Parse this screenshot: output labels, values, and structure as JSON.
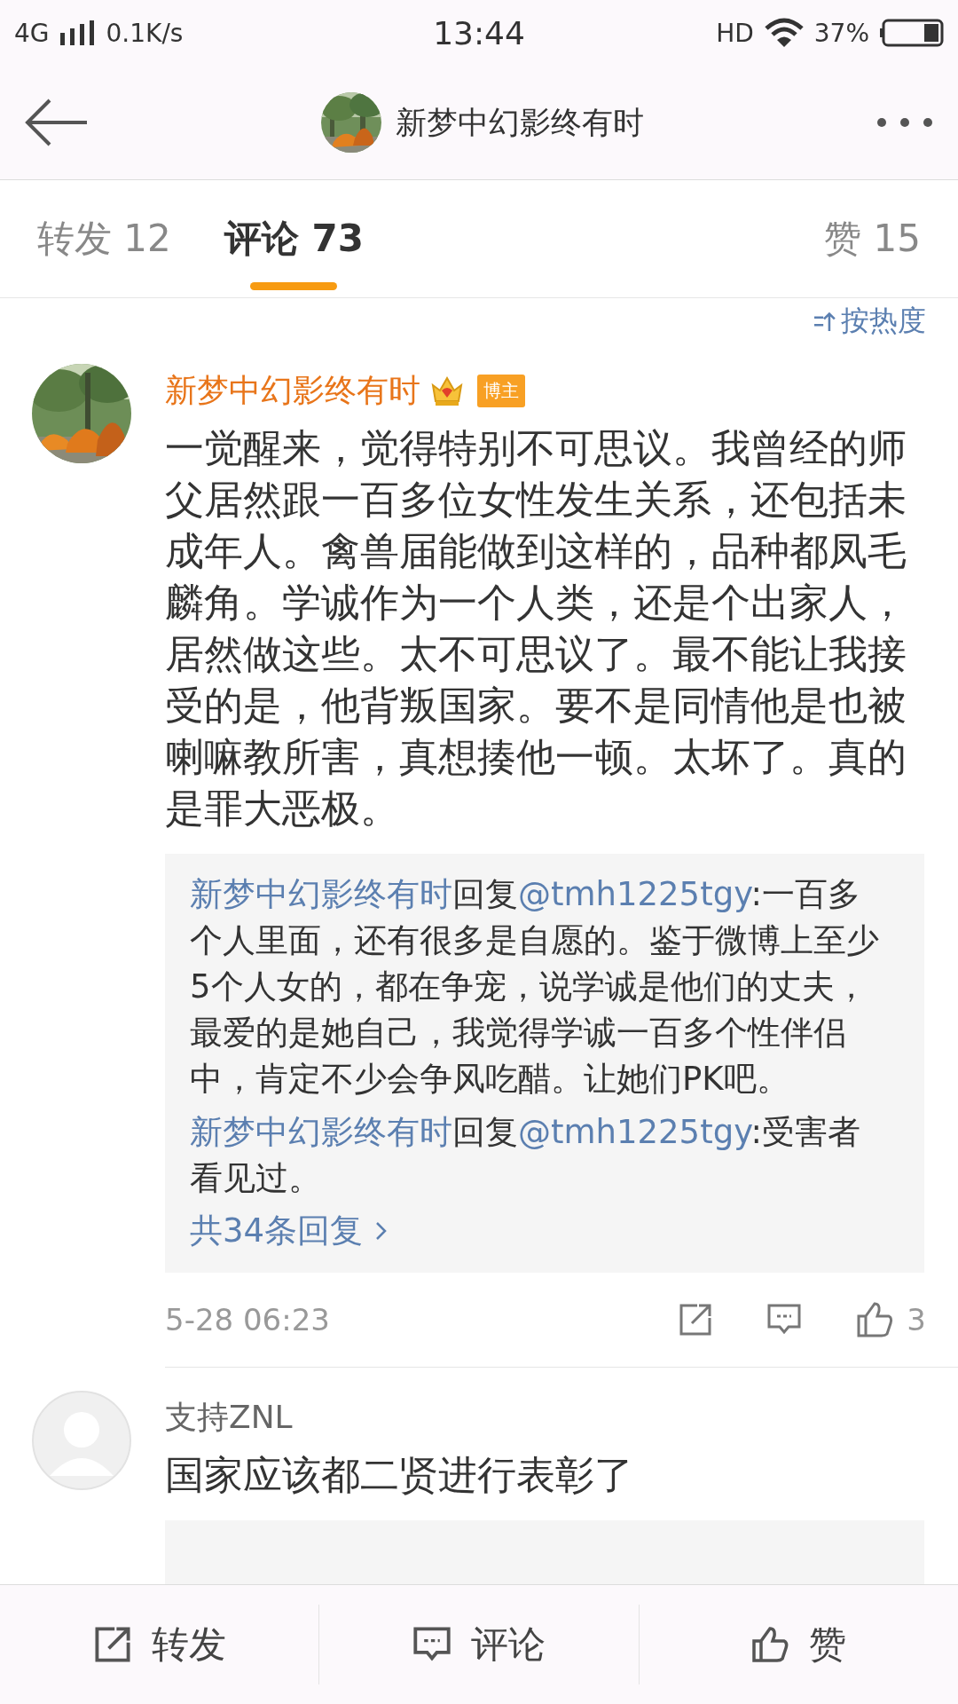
{
  "status_bar": {
    "network": "4G",
    "speed": "0.1K/s",
    "time": "13:44",
    "hd": "HD",
    "battery": "37%"
  },
  "nav": {
    "title": "新梦中幻影终有时"
  },
  "tabs": [
    {
      "label": "转发 12",
      "selected": false
    },
    {
      "label": "评论 73",
      "selected": true
    },
    {
      "label": "赞 15",
      "selected": false
    }
  ],
  "sort": {
    "label": "按热度"
  },
  "comments": [
    {
      "author": "新梦中幻影终有时",
      "vip": true,
      "badge": "博主",
      "avatar": {
        "kind": "picture"
      },
      "body": "一觉醒来，觉得特别不可思议。我曾经的师父居然跟一百多位女性发生关系，还包括未成年人。禽兽届能做到这样的，品种都凤毛麟角。学诚作为一个人类，还是个出家人，居然做这些。太不可思议了。最不能让我接受的是，他背叛国家。要不是同情他是也被喇嘛教所害，真想揍他一顿。太坏了。真的是罪大恶极。",
      "replies": [
        {
          "author": "新梦中幻影终有时",
          "action": "回复",
          "mention": "@tmh1225tgy",
          "text": ":一百多个人里面，还有很多是自愿的。鉴于微博上至少5个人女的，都在争宠，说学诚是他们的丈夫，最爱的是她自己，我觉得学诚一百多个性伴侣中，肯定不少会争风吃醋。让她们PK吧。"
        },
        {
          "author": "新梦中幻影终有时",
          "action": "回复",
          "mention": "@tmh1225tgy",
          "text": ":受害者看见过。"
        }
      ],
      "more_replies": "共34条回复",
      "time": "5-28 06:23",
      "likes": "3"
    },
    {
      "author": "支持ZNL",
      "vip": false,
      "avatar": {
        "kind": "placeholder"
      },
      "body": "国家应该都二贤进行表彰了",
      "reply_box_cut": true
    }
  ],
  "bottom_bar": [
    {
      "kind": "share",
      "label": "转发"
    },
    {
      "kind": "comment",
      "label": "评论"
    },
    {
      "kind": "like",
      "label": "赞"
    }
  ]
}
